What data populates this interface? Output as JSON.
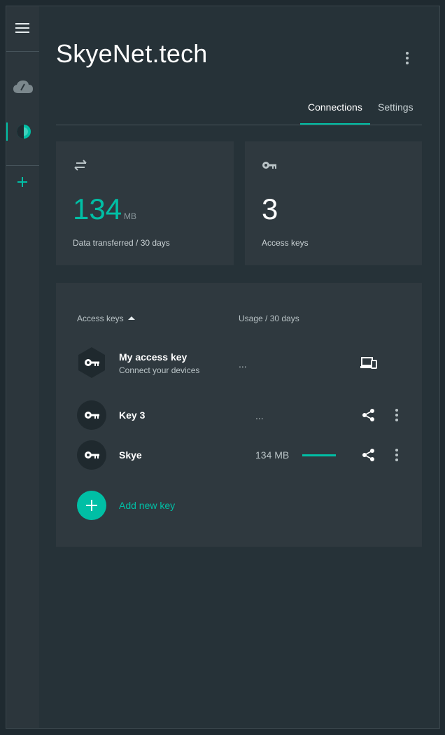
{
  "server": {
    "title": "SkyeNet.tech"
  },
  "tabs": [
    {
      "label": "Connections",
      "active": true
    },
    {
      "label": "Settings",
      "active": false
    }
  ],
  "stats": {
    "data_transferred": {
      "value": "134",
      "unit": "MB",
      "label": "Data transferred / 30 days",
      "icon": "swap-arrows-icon"
    },
    "access_keys": {
      "value": "3",
      "label": "Access keys",
      "icon": "key-icon"
    }
  },
  "keys_table": {
    "col_name": "Access keys",
    "col_usage": "Usage / 30 days",
    "rows": [
      {
        "name": "My access key",
        "subtitle": "Connect your devices",
        "usage": "...",
        "usage_fraction": null,
        "action": "devices-icon"
      },
      {
        "name": "Key 3",
        "usage": "...",
        "usage_fraction": null,
        "action": "share-icon"
      },
      {
        "name": "Skye",
        "usage": "134 MB",
        "usage_fraction": 1.0,
        "action": "share-icon"
      }
    ],
    "add_label": "Add new key"
  },
  "colors": {
    "accent": "#00bfa5",
    "background": "#263238",
    "card": "#2f393f",
    "sidebar": "#2c363c"
  }
}
